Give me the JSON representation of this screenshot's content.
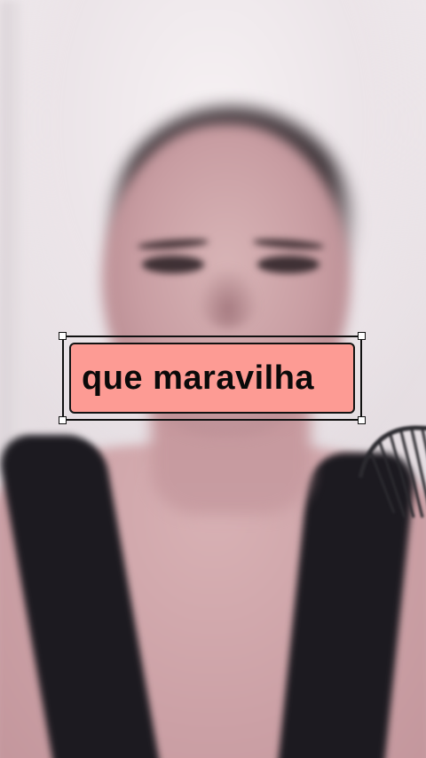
{
  "caption": {
    "text": "que maravilha",
    "background_color": "#fd9b94",
    "text_color": "#0a0a0a",
    "border_color": "#121212"
  }
}
